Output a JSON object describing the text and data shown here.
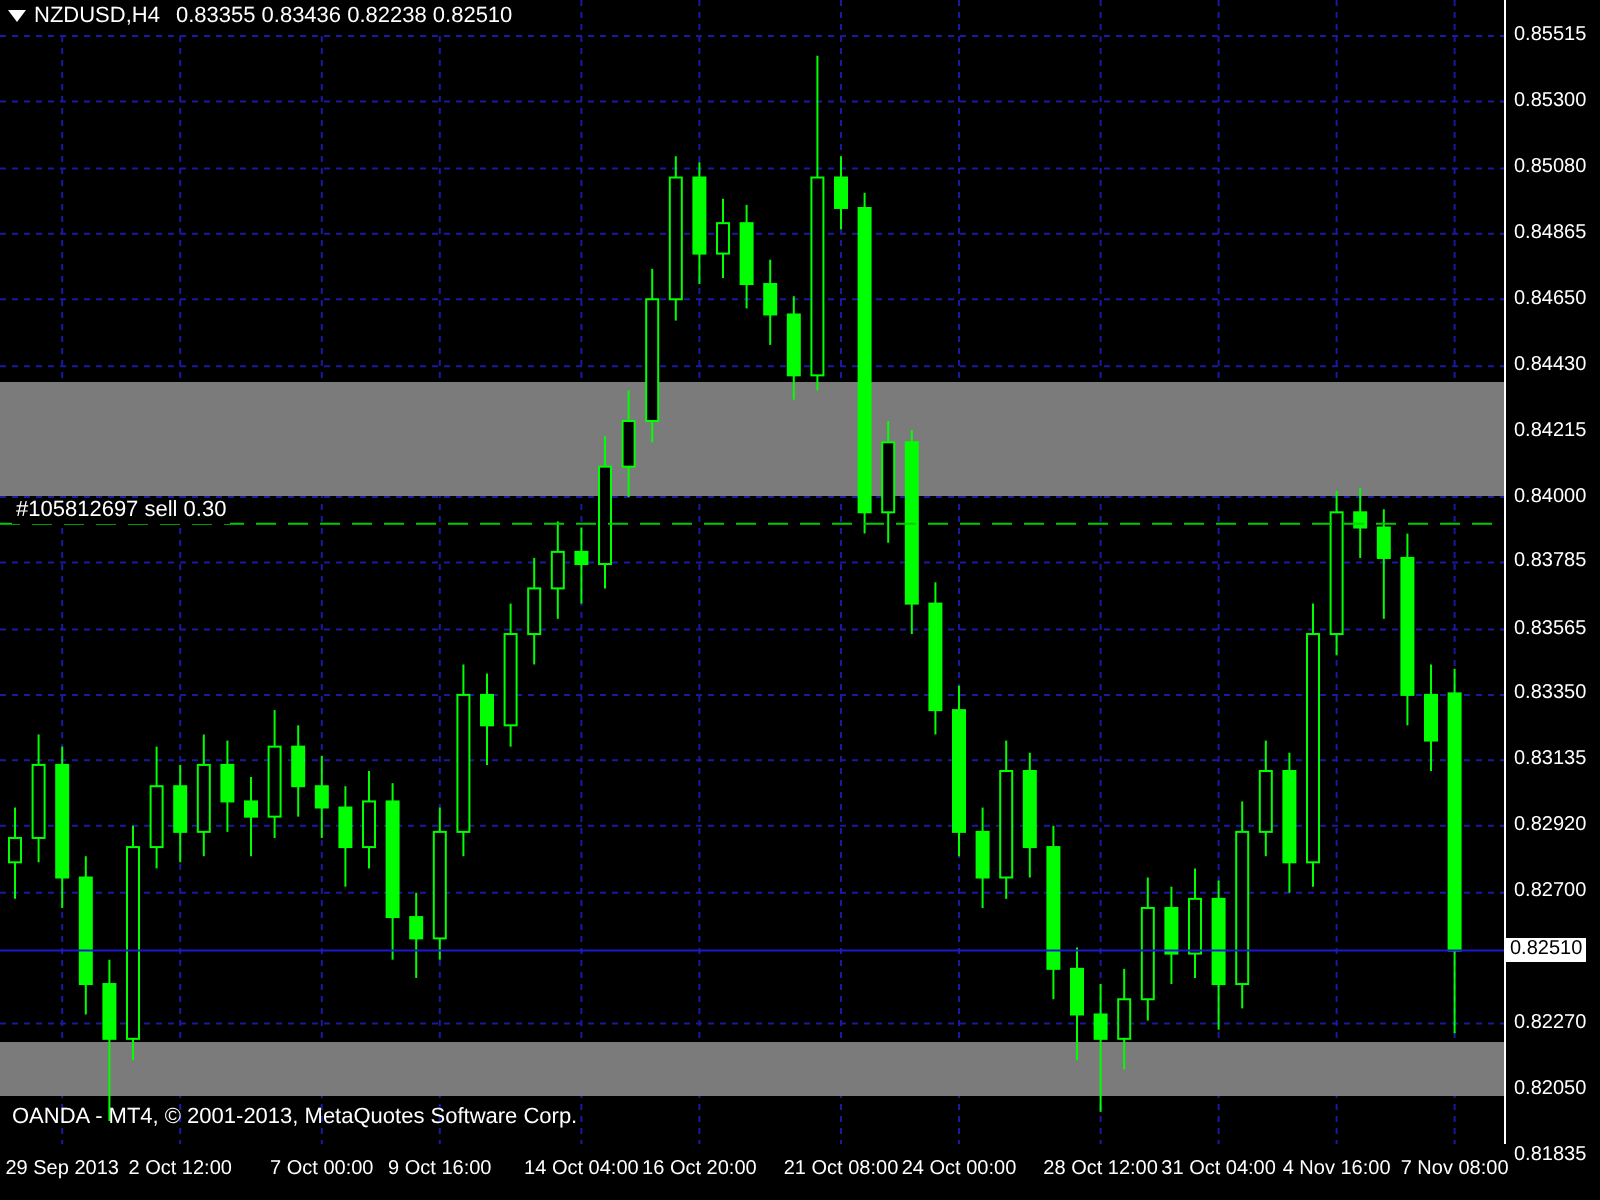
{
  "chart": {
    "symbol": "NZDUSD,H4",
    "quotes": "0.83355 0.83436 0.82238 0.82510",
    "copyright": "OANDA - MT4, © 2001-2013, MetaQuotes Software Corp.",
    "chart_data": {
      "type": "candlestick",
      "grid": true,
      "ref_lines": [
        {
          "axis": "y",
          "value": 0.83912,
          "label": "#105812697 sell 0.30",
          "color": "#00cc00"
        },
        {
          "axis": "y",
          "value": 0.8251,
          "label": "0.82510",
          "color": "#1a1ad0"
        }
      ],
      "categories": [
        null,
        null,
        "29 Sep 2013",
        null,
        null,
        null,
        null,
        "2 Oct 12:00",
        null,
        null,
        null,
        null,
        null,
        "7 Oct 00:00",
        null,
        null,
        null,
        null,
        "9 Oct 16:00",
        null,
        null,
        null,
        null,
        null,
        "14 Oct 04:00",
        null,
        null,
        null,
        null,
        "16 Oct 20:00",
        null,
        null,
        null,
        null,
        null,
        "21 Oct 08:00",
        null,
        null,
        null,
        null,
        "24 Oct 00:00",
        null,
        null,
        null,
        null,
        null,
        "28 Oct 12:00",
        null,
        null,
        null,
        null,
        "31 Oct 04:00",
        null,
        null,
        null,
        null,
        "4 Nov 16:00",
        null,
        null,
        null,
        null,
        "7 Nov 08:00"
      ],
      "ohlc": [
        [
          0.828,
          0.8298,
          0.8268,
          0.8288
        ],
        [
          0.8288,
          0.8322,
          0.828,
          0.8312
        ],
        [
          0.8312,
          0.8318,
          0.8265,
          0.8275
        ],
        [
          0.8275,
          0.8282,
          0.823,
          0.824
        ],
        [
          0.824,
          0.8248,
          0.8195,
          0.8222
        ],
        [
          0.8222,
          0.8292,
          0.8215,
          0.8285
        ],
        [
          0.8285,
          0.8318,
          0.8278,
          0.8305
        ],
        [
          0.8305,
          0.8312,
          0.828,
          0.829
        ],
        [
          0.829,
          0.8322,
          0.8282,
          0.8312
        ],
        [
          0.8312,
          0.832,
          0.829,
          0.83
        ],
        [
          0.83,
          0.8308,
          0.8282,
          0.8295
        ],
        [
          0.8295,
          0.833,
          0.8288,
          0.8318
        ],
        [
          0.8318,
          0.8325,
          0.8295,
          0.8305
        ],
        [
          0.8305,
          0.8315,
          0.8288,
          0.8298
        ],
        [
          0.8298,
          0.8305,
          0.8272,
          0.8285
        ],
        [
          0.8285,
          0.831,
          0.8278,
          0.83
        ],
        [
          0.83,
          0.8306,
          0.8248,
          0.8262
        ],
        [
          0.8262,
          0.827,
          0.8242,
          0.8255
        ],
        [
          0.8255,
          0.8298,
          0.8248,
          0.829
        ],
        [
          0.829,
          0.8345,
          0.8282,
          0.8335
        ],
        [
          0.8335,
          0.8342,
          0.8312,
          0.8325
        ],
        [
          0.8325,
          0.8365,
          0.8318,
          0.8355
        ],
        [
          0.8355,
          0.838,
          0.8345,
          0.837
        ],
        [
          0.837,
          0.8392,
          0.836,
          0.8382
        ],
        [
          0.8382,
          0.839,
          0.8365,
          0.8378
        ],
        [
          0.8378,
          0.842,
          0.837,
          0.841
        ],
        [
          0.841,
          0.8435,
          0.84,
          0.8425
        ],
        [
          0.8425,
          0.8475,
          0.8418,
          0.8465
        ],
        [
          0.8465,
          0.8512,
          0.8458,
          0.8505
        ],
        [
          0.8505,
          0.851,
          0.847,
          0.848
        ],
        [
          0.848,
          0.8498,
          0.8472,
          0.849
        ],
        [
          0.849,
          0.8496,
          0.8462,
          0.847
        ],
        [
          0.847,
          0.8478,
          0.845,
          0.846
        ],
        [
          0.846,
          0.8466,
          0.8432,
          0.844
        ],
        [
          0.844,
          0.8545,
          0.8435,
          0.8505
        ],
        [
          0.8505,
          0.8512,
          0.8488,
          0.8495
        ],
        [
          0.8495,
          0.85,
          0.8388,
          0.8395
        ],
        [
          0.8395,
          0.8425,
          0.8385,
          0.8418
        ],
        [
          0.8418,
          0.8422,
          0.8355,
          0.8365
        ],
        [
          0.8365,
          0.8372,
          0.8322,
          0.833
        ],
        [
          0.833,
          0.8338,
          0.8282,
          0.829
        ],
        [
          0.829,
          0.8298,
          0.8265,
          0.8275
        ],
        [
          0.8275,
          0.832,
          0.8268,
          0.831
        ],
        [
          0.831,
          0.8316,
          0.8275,
          0.8285
        ],
        [
          0.8285,
          0.8292,
          0.8235,
          0.8245
        ],
        [
          0.8245,
          0.8252,
          0.8215,
          0.823
        ],
        [
          0.823,
          0.824,
          0.8198,
          0.8222
        ],
        [
          0.8222,
          0.8245,
          0.8212,
          0.8235
        ],
        [
          0.8235,
          0.8275,
          0.8228,
          0.8265
        ],
        [
          0.8265,
          0.8272,
          0.824,
          0.825
        ],
        [
          0.825,
          0.8278,
          0.8242,
          0.8268
        ],
        [
          0.8268,
          0.8274,
          0.8225,
          0.824
        ],
        [
          0.824,
          0.83,
          0.8232,
          0.829
        ],
        [
          0.829,
          0.832,
          0.8282,
          0.831
        ],
        [
          0.831,
          0.8316,
          0.827,
          0.828
        ],
        [
          0.828,
          0.8365,
          0.8272,
          0.8355
        ],
        [
          0.8355,
          0.8402,
          0.8348,
          0.8395
        ],
        [
          0.8395,
          0.8403,
          0.838,
          0.839
        ],
        [
          0.839,
          0.8396,
          0.836,
          0.838
        ],
        [
          0.838,
          0.8388,
          0.8325,
          0.8335
        ],
        [
          0.8335,
          0.8345,
          0.831,
          0.832
        ],
        [
          0.83355,
          0.83436,
          0.82238,
          0.8251
        ]
      ],
      "ylim": [
        0.81835,
        0.85515
      ],
      "yticks": [
        {
          "value": 0.85515,
          "label": "0.85515"
        },
        {
          "value": 0.853,
          "label": "0.85300"
        },
        {
          "value": 0.8508,
          "label": "0.85080"
        },
        {
          "value": 0.84865,
          "label": "0.84865"
        },
        {
          "value": 0.8465,
          "label": "0.84650"
        },
        {
          "value": 0.8443,
          "label": "0.84430"
        },
        {
          "value": 0.84215,
          "label": "0.84215"
        },
        {
          "value": 0.84,
          "label": "0.84000"
        },
        {
          "value": 0.83785,
          "label": "0.83785"
        },
        {
          "value": 0.83565,
          "label": "0.83565"
        },
        {
          "value": 0.8335,
          "label": "0.83350"
        },
        {
          "value": 0.83135,
          "label": "0.83135"
        },
        {
          "value": 0.8292,
          "label": "0.82920"
        },
        {
          "value": 0.827,
          "label": "0.82700"
        },
        {
          "value": 0.8227,
          "label": "0.82270"
        },
        {
          "value": 0.8205,
          "label": "0.82050"
        },
        {
          "value": 0.81835,
          "label": "0.81835"
        }
      ]
    }
  }
}
